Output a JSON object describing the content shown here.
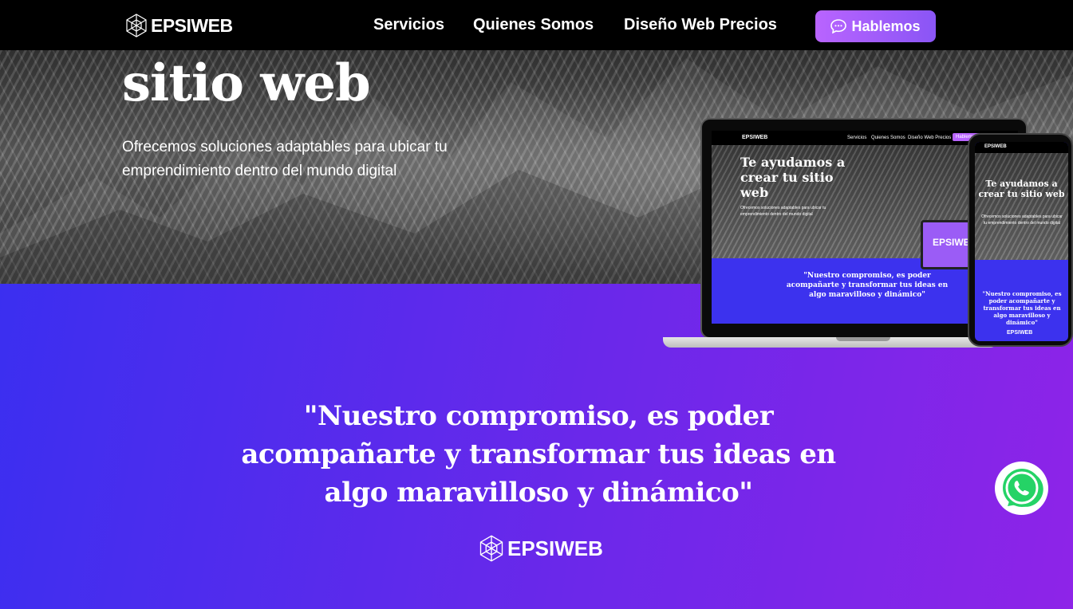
{
  "navbar": {
    "brand": "EPSIWEB",
    "links": [
      {
        "label": "Servicios"
      },
      {
        "label": "Quienes Somos"
      },
      {
        "label": "Diseño Web Precios"
      }
    ],
    "cta_label": "Hablemos"
  },
  "hero": {
    "title": "sitio web",
    "subtitle": "Ofrecemos soluciones adaptables para ubicar tu emprendimiento dentro del mundo digital"
  },
  "mockup": {
    "brand": "EPSIWEB",
    "nav_links": [
      "Servicios",
      "Quienes Somos",
      "Diseño Web Precios",
      "Hablemos"
    ],
    "title": "Te ayudamos a crear tu sitio web",
    "subtitle": "Ofrecemos soluciones adaptables para ubicar tu emprendimiento dentro del mundo digital",
    "quote": "\"Nuestro compromiso, es poder acompañarte y transformar tus ideas en algo maravilloso y dinámico\"",
    "laptop_logo": "EPSIWEB"
  },
  "quote_section": {
    "quote": "\"Nuestro compromiso, es poder acompañarte y transformar tus ideas en algo maravilloso y dinámico\"",
    "brand": "EPSIWEB"
  },
  "colors": {
    "gradient_start": "#3b2ff0",
    "gradient_end": "#8e24e8",
    "cta": "#b964ff",
    "whatsapp": "#25d366"
  },
  "icons": [
    "logo-icon",
    "chat-icon",
    "whatsapp-icon"
  ]
}
